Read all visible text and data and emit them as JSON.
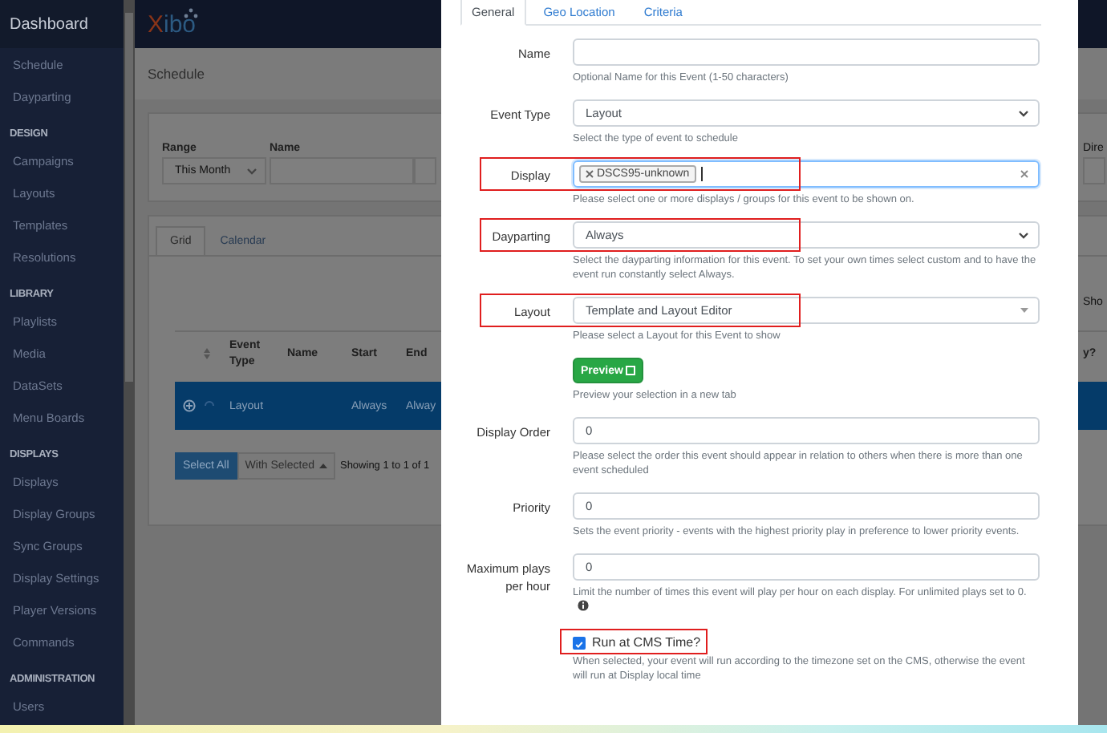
{
  "sidebar": {
    "title": "Dashboard",
    "items": [
      {
        "kind": "item",
        "label": "Schedule"
      },
      {
        "kind": "item",
        "label": "Dayparting"
      },
      {
        "kind": "header",
        "label": "DESIGN"
      },
      {
        "kind": "item",
        "label": "Campaigns"
      },
      {
        "kind": "item",
        "label": "Layouts"
      },
      {
        "kind": "item",
        "label": "Templates"
      },
      {
        "kind": "item",
        "label": "Resolutions"
      },
      {
        "kind": "header",
        "label": "LIBRARY"
      },
      {
        "kind": "item",
        "label": "Playlists"
      },
      {
        "kind": "item",
        "label": "Media"
      },
      {
        "kind": "item",
        "label": "DataSets"
      },
      {
        "kind": "item",
        "label": "Menu Boards"
      },
      {
        "kind": "header",
        "label": "DISPLAYS"
      },
      {
        "kind": "item",
        "label": "Displays"
      },
      {
        "kind": "item",
        "label": "Display Groups"
      },
      {
        "kind": "item",
        "label": "Sync Groups"
      },
      {
        "kind": "item",
        "label": "Display Settings"
      },
      {
        "kind": "item",
        "label": "Player Versions"
      },
      {
        "kind": "item",
        "label": "Commands"
      },
      {
        "kind": "header",
        "label": "ADMINISTRATION"
      },
      {
        "kind": "item",
        "label": "Users"
      }
    ]
  },
  "header": {
    "logo": "Xibo"
  },
  "page": {
    "title": "Schedule",
    "filters": [
      {
        "kind": "select",
        "label": "Range",
        "value": "This Month"
      },
      {
        "kind": "text",
        "label": "Name"
      }
    ],
    "filter_right_label": "Dire",
    "tabs": [
      {
        "label": "Grid",
        "selected": true
      },
      {
        "label": "Calendar",
        "selected": false
      }
    ],
    "show_label": "Sho",
    "table": {
      "columns": [
        "Event Type",
        "Name",
        "Start",
        "End"
      ],
      "column_cut": "y?",
      "rows": [
        {
          "event_type": "Layout",
          "start": "Always",
          "end": "Alway",
          "selected": true
        }
      ]
    },
    "select_all": "Select All",
    "with_selected": "With Selected",
    "showing": "Showing 1 to 1 of 1"
  },
  "modal": {
    "tabs": [
      {
        "label": "General",
        "selected": true
      },
      {
        "label": "Geo Location",
        "selected": false
      },
      {
        "label": "Criteria",
        "selected": false
      }
    ],
    "fields": [
      {
        "kind": "text",
        "label": "Name",
        "help": "Optional Name for this Event (1-50 characters)",
        "highlighted": false
      },
      {
        "kind": "select",
        "label": "Event Type",
        "value": "Layout",
        "help": "Select the type of event to schedule",
        "highlighted": false
      },
      {
        "kind": "tags",
        "label": "Display",
        "tags": [
          "DSCS95-unknown"
        ],
        "help": "Please select one or more displays / groups for this event to be shown on.",
        "highlighted": true
      },
      {
        "kind": "select",
        "label": "Dayparting",
        "value": "Always",
        "help": "Select the dayparting information for this event. To set your own times select custom and to have the event run constantly select Always.",
        "highlighted": true
      },
      {
        "kind": "combo",
        "label": "Layout",
        "value": "Template and Layout Editor",
        "help": "Please select a Layout for this Event to show",
        "highlighted": true
      },
      {
        "kind": "button",
        "label": "Preview",
        "help": "Preview your selection in a new tab",
        "highlighted": false
      },
      {
        "kind": "text",
        "label": "Display Order",
        "value": "0",
        "help": "Please select the order this event should appear in relation to others when there is more than one event scheduled",
        "highlighted": false
      },
      {
        "kind": "text",
        "label": "Priority",
        "value": "0",
        "help": "Sets the event priority - events with the highest priority play in preference to lower priority events.",
        "highlighted": false
      },
      {
        "kind": "text",
        "label": "Maximum plays per hour",
        "value": "0",
        "help": "Limit the number of times this event will play per hour on each display. For unlimited plays set to 0.",
        "help_icon": true,
        "highlighted": false
      },
      {
        "kind": "checkbox",
        "label": "Run at CMS Time?",
        "checked": true,
        "help": "When selected, your event will run according to the timezone set on the CMS, otherwise the event will run at Display local time",
        "highlighted": true
      }
    ]
  }
}
